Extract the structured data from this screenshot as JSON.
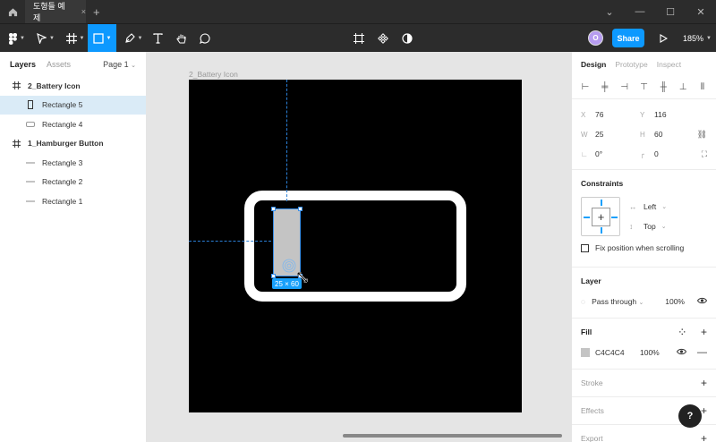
{
  "titlebar": {
    "tab_title": "도형들 예제",
    "tab_close": "×",
    "new_tab": "+",
    "window_controls": [
      "⌄",
      "—",
      "☐",
      "✕"
    ]
  },
  "toolbar": {
    "share_label": "Share",
    "zoom_label": "185%",
    "avatar_initial": "O",
    "tools": [
      "main-menu",
      "move-tool",
      "frame-tool",
      "shape-tool",
      "pen-tool",
      "text-tool",
      "hand-tool",
      "comment-tool",
      "crop-tool",
      "component-tool",
      "mask-tool",
      "present"
    ],
    "accent_color": "#0d99ff"
  },
  "left_panel": {
    "tabs": {
      "layers": "Layers",
      "assets": "Assets",
      "page": "Page 1"
    },
    "layers": [
      {
        "label": "2_Battery Icon",
        "type": "frame",
        "selected": false
      },
      {
        "label": "Rectangle 5",
        "type": "rect-v",
        "selected": true
      },
      {
        "label": "Rectangle 4",
        "type": "rect-h",
        "selected": false
      },
      {
        "label": "1_Hamburger Button",
        "type": "frame",
        "selected": false
      },
      {
        "label": "Rectangle 3",
        "type": "line",
        "selected": false
      },
      {
        "label": "Rectangle 2",
        "type": "line",
        "selected": false
      },
      {
        "label": "Rectangle 1",
        "type": "line",
        "selected": false
      }
    ]
  },
  "canvas": {
    "frame_label": "2_Battery Icon",
    "dimensions_badge": "25 × 60"
  },
  "right_panel": {
    "tabs": {
      "design": "Design",
      "prototype": "Prototype",
      "inspect": "Inspect"
    },
    "props": {
      "x_label": "X",
      "x": "76",
      "y_label": "Y",
      "y": "116",
      "w_label": "W",
      "w": "25",
      "h_label": "H",
      "h": "60",
      "rotation": "0°",
      "radius": "0"
    },
    "constraints": {
      "title": "Constraints",
      "horizontal": "Left",
      "vertical": "Top",
      "fix_position": "Fix position when scrolling"
    },
    "layer": {
      "title": "Layer",
      "blend": "Pass through",
      "opacity": "100%"
    },
    "fill": {
      "title": "Fill",
      "hex": "C4C4C4",
      "opacity": "100%",
      "color": "#c4c4c4"
    },
    "stroke_title": "Stroke",
    "effects_title": "Effects",
    "export_title": "Export",
    "help": "?"
  }
}
